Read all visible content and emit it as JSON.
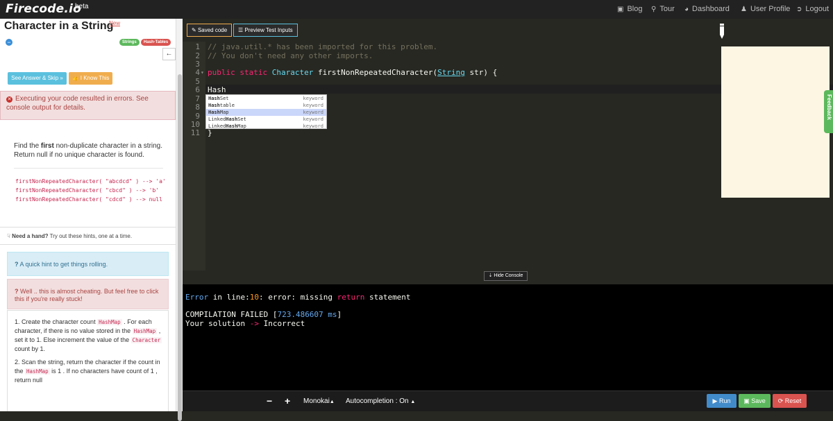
{
  "navbar": {
    "logo": "Firecode.io",
    "beta": "beta",
    "links": [
      {
        "label": "Blog",
        "icon": "rss-icon"
      },
      {
        "label": "Tour",
        "icon": "map-marker-icon"
      },
      {
        "label": "Dashboard",
        "icon": "dashboard-icon"
      },
      {
        "label": "User Profile",
        "icon": "user-icon"
      },
      {
        "label": "Logout",
        "icon": "logout-icon"
      }
    ]
  },
  "problem": {
    "title": "Character in a String",
    "new_badge": "New",
    "tags": [
      "Strings",
      "Hash-Tables"
    ],
    "see_answer_label": "See Answer & Skip",
    "i_know_label": "I Know This",
    "error_message": "Executing your code resulted in errors. See console output for details.",
    "desc_pre": "Find the ",
    "desc_bold": "first",
    "desc_post": " non-duplicate character in a string. Return null if no unique character is found.",
    "examples": [
      "firstNonRepeatedCharacter( \"abcdcd\" ) --> 'a'",
      "firstNonRepeatedCharacter( \"cbcd\" ) --> 'b'",
      "firstNonRepeatedCharacter( \"cdcd\" ) --> null"
    ],
    "need_hand_bold": "Need a hand?",
    "need_hand_rest": " Try out these hints, one at a time.",
    "hint_quick": "A quick hint to get things rolling.",
    "hint_cheat": "Well .. this is almost cheating. But feel free to click this if you're really stuck!",
    "hint_steps": {
      "s1a": "1. Create the character count ",
      "s1k1": "HashMap",
      "s1b": " . For each character, if there is no value stored in the ",
      "s1k2": "HashMap",
      "s1c": " , set it to 1. Else increment the value of the ",
      "s1k3": "Character",
      "s1d": " count by 1.",
      "s2a": "2. Scan the string, return the character if the count in the ",
      "s2k1": "HashMap",
      "s2b": " is 1 . If no characters have count of 1 , return null"
    }
  },
  "editor": {
    "saved_label": "Saved code",
    "preview_label": "Preview Test Inputs",
    "line_numbers": [
      "1",
      "2",
      "3",
      "4",
      "5",
      "6",
      "7",
      "8",
      "9",
      "10",
      "11"
    ],
    "code": {
      "l1": "// java.util.* has been imported for this problem.",
      "l2": "// You don't need any other imports.",
      "l4_kw1": "public",
      "l4_kw2": "static",
      "l4_type": "Character",
      "l4_name": "firstNonRepeatedCharacter(",
      "l4_param": "String",
      "l4_rest": " str) {",
      "l6": "Hash",
      "l11": "}"
    },
    "autocomplete": [
      {
        "bold": "Hash",
        "rest": "Set",
        "meta": "keyword"
      },
      {
        "bold": "Hash",
        "rest": "table",
        "meta": "keyword"
      },
      {
        "bold": "Hash",
        "rest": "Map",
        "meta": "keyword"
      },
      {
        "pre": "Linked",
        "bold": "Hash",
        "rest": "Set",
        "meta": "keyword"
      },
      {
        "pre": "Linked",
        "bold": "Hash",
        "rest": "Map",
        "meta": "keyword"
      }
    ],
    "feedback_label": "Feedback"
  },
  "console": {
    "hide_label": "Hide Console",
    "err_word": "Error",
    "err_mid": " in line:",
    "err_line": "10",
    "err_rest": ": error: missing ",
    "err_kw": "return",
    "err_end": " statement",
    "compile_pre": "COMPILATION FAILED [",
    "compile_time": "723.486607 ms",
    "compile_post": "]",
    "sol_pre": "Your solution ",
    "sol_arrow": "->",
    "sol_post": " Incorrect"
  },
  "bottom": {
    "minus": "−",
    "plus": "+",
    "theme": "Monokai",
    "autocompletion": "Autocompletion : On",
    "run": "Run",
    "save": "Save",
    "reset": "Reset"
  }
}
